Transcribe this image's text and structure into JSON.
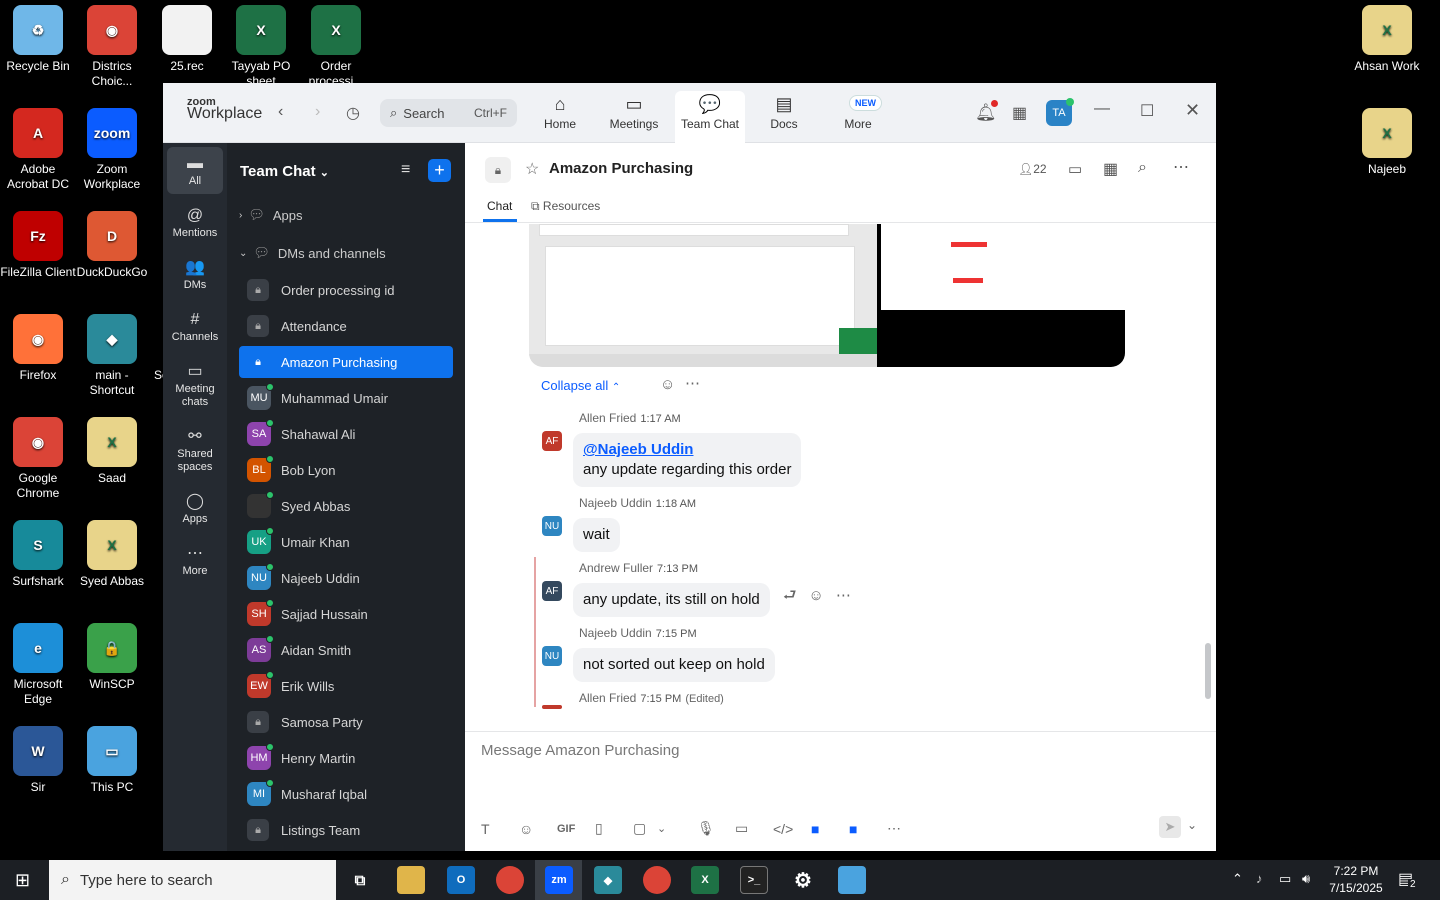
{
  "desktop": {
    "icons_left": [
      {
        "label": "Recycle Bin",
        "color": "#6fb7e8",
        "glyph": "♻"
      },
      {
        "label": "Districs Choic...",
        "color": "#db4437",
        "glyph": "◉"
      },
      {
        "label": "25.rec",
        "color": "#f2f2f2",
        "glyph": ""
      },
      {
        "label": "Tayyab PO sheet",
        "color": "#1e7145",
        "glyph": "X"
      },
      {
        "label": "Order processi...",
        "color": "#1e7145",
        "glyph": "X"
      },
      {
        "label": "Adobe Acrobat DC",
        "color": "#d4281f",
        "glyph": "A"
      },
      {
        "label": "Zoom Workplace",
        "color": "#0b5cff",
        "glyph": "zoom"
      },
      {
        "label": "FileZilla Client",
        "color": "#bf0000",
        "glyph": "Fz"
      },
      {
        "label": "DuckDuckGo",
        "color": "#de5833",
        "glyph": "D"
      },
      {
        "label": "Firefox",
        "color": "#ff7139",
        "glyph": "◉"
      },
      {
        "label": "main - Shortcut",
        "color": "#2a8a9a",
        "glyph": "◆"
      },
      {
        "label": "Google Chrome",
        "color": "#db4437",
        "glyph": "◉"
      },
      {
        "label": "Saad",
        "color": "#e8d48a",
        "glyph": "X"
      },
      {
        "label": "Surfshark",
        "color": "#178a9a",
        "glyph": "S"
      },
      {
        "label": "Syed Abbas",
        "color": "#e8d48a",
        "glyph": "X"
      },
      {
        "label": "Microsoft Edge",
        "color": "#1d8fd8",
        "glyph": "e"
      },
      {
        "label": "WinSCP",
        "color": "#3aa14a",
        "glyph": "🔒"
      },
      {
        "label": "Sir",
        "color": "#2b5797",
        "glyph": "W"
      },
      {
        "label": "This PC",
        "color": "#4aa3df",
        "glyph": "▭"
      }
    ],
    "icons_right": [
      {
        "label": "Ahsan Work",
        "color": "#e8d48a",
        "glyph": "X"
      },
      {
        "label": "Najeeb",
        "color": "#e8d48a",
        "glyph": "X"
      }
    ],
    "partial_label": "Sc"
  },
  "app": {
    "logo_top": "zoom",
    "logo_bottom": "Workplace",
    "search_label": "Search",
    "search_shortcut": "Ctrl+F",
    "nav": [
      {
        "label": "Home",
        "glyph": "⌂"
      },
      {
        "label": "Meetings",
        "glyph": "▭"
      },
      {
        "label": "Team Chat",
        "glyph": "💬"
      },
      {
        "label": "Docs",
        "glyph": "▤"
      },
      {
        "label": "More",
        "glyph": "⋯"
      }
    ],
    "new_badge": "NEW",
    "avatar_initials": "TA"
  },
  "rail": [
    {
      "label": "All",
      "glyph": "▬"
    },
    {
      "label": "Mentions",
      "glyph": "@"
    },
    {
      "label": "DMs",
      "glyph": "👥"
    },
    {
      "label": "Channels",
      "glyph": "#"
    },
    {
      "label": "Meeting chats",
      "glyph": "▭"
    },
    {
      "label": "Shared spaces",
      "glyph": "⚯"
    },
    {
      "label": "Apps",
      "glyph": "◯"
    },
    {
      "label": "More",
      "glyph": "⋯"
    }
  ],
  "sidebar": {
    "title": "Team Chat",
    "apps_label": "Apps",
    "dms_label": "DMs and channels",
    "items": [
      {
        "kind": "channel",
        "label": "Order processing id"
      },
      {
        "kind": "channel",
        "label": "Attendance"
      },
      {
        "kind": "channel",
        "label": "Amazon Purchasing",
        "active": true
      },
      {
        "kind": "dm",
        "initials": "MU",
        "label": "Muhammad Umair",
        "color": "#4a5561"
      },
      {
        "kind": "dm",
        "initials": "SA",
        "label": "Shahawal Ali",
        "color": "#8e44ad"
      },
      {
        "kind": "dm",
        "initials": "BL",
        "label": "Bob Lyon",
        "color": "#d35400"
      },
      {
        "kind": "dm",
        "initials": "",
        "label": "Syed Abbas",
        "color": "#333333"
      },
      {
        "kind": "dm",
        "initials": "UK",
        "label": "Umair Khan",
        "color": "#16a085"
      },
      {
        "kind": "dm",
        "initials": "NU",
        "label": "Najeeb Uddin",
        "color": "#2e86c1"
      },
      {
        "kind": "dm",
        "initials": "SH",
        "label": "Sajjad Hussain",
        "color": "#c0392b"
      },
      {
        "kind": "dm",
        "initials": "AS",
        "label": "Aidan Smith",
        "color": "#7d3c98"
      },
      {
        "kind": "dm",
        "initials": "EW",
        "label": "Erik Wills",
        "color": "#c0392b"
      },
      {
        "kind": "channel",
        "label": "Samosa Party"
      },
      {
        "kind": "dm",
        "initials": "HM",
        "label": "Henry Martin",
        "color": "#8e44ad"
      },
      {
        "kind": "dm",
        "initials": "MI",
        "label": "Musharaf Iqbal",
        "color": "#2e86c1"
      },
      {
        "kind": "channel",
        "label": "Listings Team"
      }
    ]
  },
  "channel": {
    "name": "Amazon Purchasing",
    "member_count": "22",
    "tabs": [
      "Chat",
      "Resources"
    ],
    "collapse_label": "Collapse all",
    "composer_placeholder": "Message Amazon Purchasing",
    "gif_label": "GIF"
  },
  "messages": [
    {
      "initials": "AF",
      "color": "#c0392b",
      "author": "Allen Fried",
      "time": "1:17 AM",
      "mention": "@Najeeb Uddin",
      "text": "any update regarding this order"
    },
    {
      "initials": "NU",
      "color": "#2e86c1",
      "author": "Najeeb Uddin",
      "time": "1:18 AM",
      "text": "wait"
    },
    {
      "initials": "AF",
      "color": "#34495e",
      "author": "Andrew Fuller",
      "time": "7:13 PM",
      "text": "any update, its still on hold"
    },
    {
      "initials": "NU",
      "color": "#2e86c1",
      "author": "Najeeb Uddin",
      "time": "7:15 PM",
      "text": "not sorted out keep on hold"
    },
    {
      "initials": "",
      "color": "#c0392b",
      "author": "Allen Fried",
      "time": "7:15 PM",
      "edited": "(Edited)",
      "text": ""
    }
  ],
  "taskbar": {
    "search_placeholder": "Type here to search",
    "time": "7:22 PM",
    "date": "7/15/2025",
    "notification_count": "2"
  }
}
